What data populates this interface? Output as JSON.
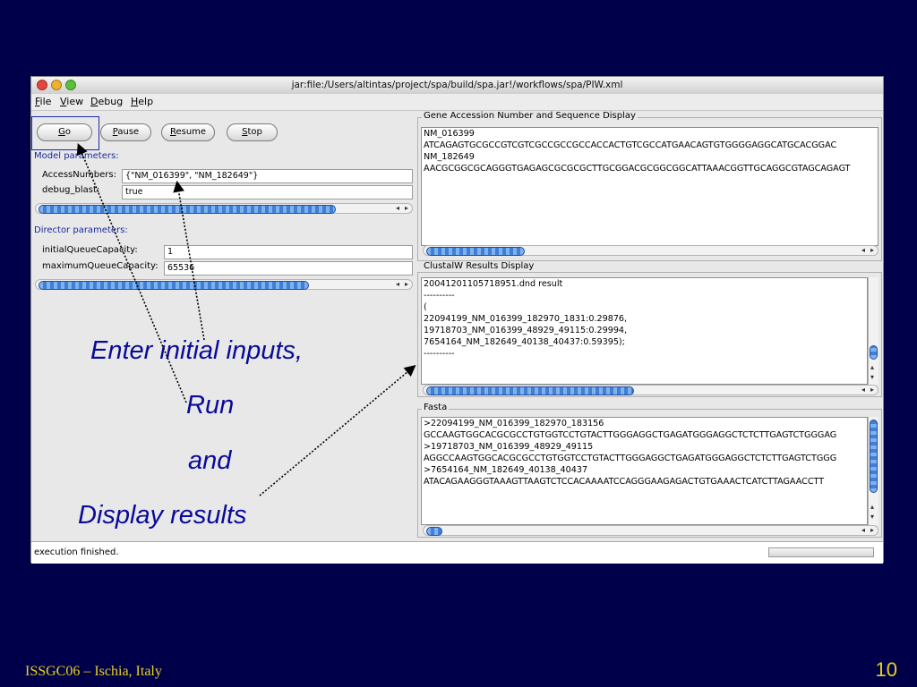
{
  "window": {
    "title": "jar:file:/Users/altintas/project/spa/build/spa.jar!/workflows/spa/PIW.xml",
    "menus": [
      "File",
      "View",
      "Debug",
      "Help"
    ]
  },
  "toolbar": {
    "go_label": "Go",
    "pause_label": "Pause",
    "resume_label": "Resume",
    "stop_label": "Stop"
  },
  "model_params": {
    "heading": "Model parameters:",
    "rows": [
      {
        "label": "AccessNumbers:",
        "value": "{\"NM_016399\", \"NM_182649\"}"
      },
      {
        "label": "debug_blast:",
        "value": "true"
      }
    ]
  },
  "director_params": {
    "heading": "Director parameters:",
    "rows": [
      {
        "label": "initialQueueCapacity:",
        "value": "1"
      },
      {
        "label": "maximumQueueCapacity:",
        "value": "65536"
      }
    ]
  },
  "gene_panel": {
    "title": "Gene Accession Number and Sequence Display",
    "lines": [
      "NM_016399",
      "ATCAGAGTGCGCCGTCGTCGCCGCCGCCACCACTGTCGCCATGAACAGTGTGGGGAGGCATGCACGGAC",
      "NM_182649",
      "AACGCGGCGCAGGGTGAGAGCGCGCGCTTGCGGACGCGGCGGCATTAAACGGTTGCAGGCGTAGCAGAGT"
    ]
  },
  "clustal_panel": {
    "title": "ClustalW Results Display",
    "lines": [
      "",
      "20041201105718951.dnd result",
      "----------",
      "(",
      "22094199_NM_016399_182970_1831:0.29876,",
      "19718703_NM_016399_48929_49115:0.29994,",
      "7654164_NM_182649_40138_40437:0.59395);",
      "----------"
    ]
  },
  "fasta_panel": {
    "title": "Fasta",
    "lines": [
      ">22094199_NM_016399_182970_183156",
      "GCCAAGTGGCACGCGCCTGTGGTCCTGTACTTGGGAGGCTGAGATGGGAGGCTCTCTTGAGTCTGGGAG",
      ">19718703_NM_016399_48929_49115",
      "AGGCCAAGTGGCACGCGCCTGTGGTCCTGTACTTGGGAGGCTGAGATGGGAGGCTCTCTTGAGTCTGGG",
      ">7654164_NM_182649_40138_40437",
      "ATACAGAAGGGTAAAGTTAAGTCTCCACAAAATCCAGGGAAGAGACTGTGAAACTCATCTTAGAACCTT"
    ]
  },
  "status": {
    "text": "execution finished."
  },
  "annotation": {
    "line1": "Enter initial inputs,",
    "line2": "Run",
    "line3": "and",
    "line4": "Display results"
  },
  "footer": {
    "left": "ISSGC06 – Ischia, Italy",
    "page": "10"
  },
  "colors": {
    "background": "#00004a",
    "annotation_text": "#0a0a9a",
    "footer_text": "#e8d21c",
    "section_heading": "#1a2a9a"
  },
  "icons": {
    "close": "close-circle-icon",
    "minimize": "minimize-circle-icon",
    "maximize": "maximize-circle-icon",
    "scroll_left": "arrow-left-icon",
    "scroll_right": "arrow-right-icon",
    "scroll_up": "arrow-up-icon",
    "scroll_down": "arrow-down-icon"
  }
}
